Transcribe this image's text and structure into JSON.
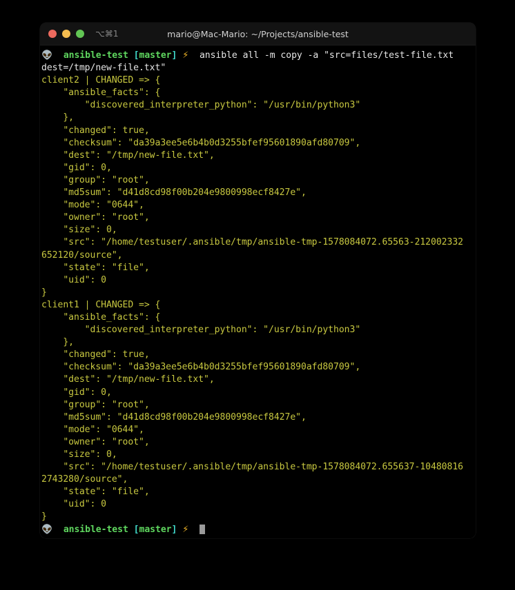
{
  "window": {
    "title": "mario@Mac-Mario: ~/Projects/ansible-test",
    "shortcut": "⌥⌘1",
    "traffic_lights": [
      {
        "name": "close",
        "color": "#ed6a5e"
      },
      {
        "name": "minimize",
        "color": "#f5bd4f"
      },
      {
        "name": "zoom",
        "color": "#62c554"
      }
    ]
  },
  "colors": {
    "background": "#000000",
    "titlebar": "#131313",
    "output_text": "#c8c840",
    "command_text": "#e6e6e6",
    "branch_text": "#5fd75f",
    "bracket_text": "#3fd6c8",
    "bolt": "#f0b528",
    "cursor": "#9a9a9a"
  },
  "prompt": {
    "emoji": "👽",
    "repo": "ansible-test",
    "bracket_open": "[",
    "branch": "master",
    "bracket_close": "]",
    "bolt": "⚡"
  },
  "command": {
    "line1": "ansible all -m copy -a \"src=files/test-file.txt",
    "line2": "dest=/tmp/new-file.txt\""
  },
  "output_lines": [
    "client2 | CHANGED => {",
    "    \"ansible_facts\": {",
    "        \"discovered_interpreter_python\": \"/usr/bin/python3\"",
    "    },",
    "    \"changed\": true,",
    "    \"checksum\": \"da39a3ee5e6b4b0d3255bfef95601890afd80709\",",
    "    \"dest\": \"/tmp/new-file.txt\",",
    "    \"gid\": 0,",
    "    \"group\": \"root\",",
    "    \"md5sum\": \"d41d8cd98f00b204e9800998ecf8427e\",",
    "    \"mode\": \"0644\",",
    "    \"owner\": \"root\",",
    "    \"size\": 0,",
    "    \"src\": \"/home/testuser/.ansible/tmp/ansible-tmp-1578084072.65563-212002332",
    "652120/source\",",
    "    \"state\": \"file\",",
    "    \"uid\": 0",
    "}",
    "client1 | CHANGED => {",
    "    \"ansible_facts\": {",
    "        \"discovered_interpreter_python\": \"/usr/bin/python3\"",
    "    },",
    "    \"changed\": true,",
    "    \"checksum\": \"da39a3ee5e6b4b0d3255bfef95601890afd80709\",",
    "    \"dest\": \"/tmp/new-file.txt\",",
    "    \"gid\": 0,",
    "    \"group\": \"root\",",
    "    \"md5sum\": \"d41d8cd98f00b204e9800998ecf8427e\",",
    "    \"mode\": \"0644\",",
    "    \"owner\": \"root\",",
    "    \"size\": 0,",
    "    \"src\": \"/home/testuser/.ansible/tmp/ansible-tmp-1578084072.655637-10480816",
    "2743280/source\",",
    "    \"state\": \"file\",",
    "    \"uid\": 0",
    "}"
  ]
}
